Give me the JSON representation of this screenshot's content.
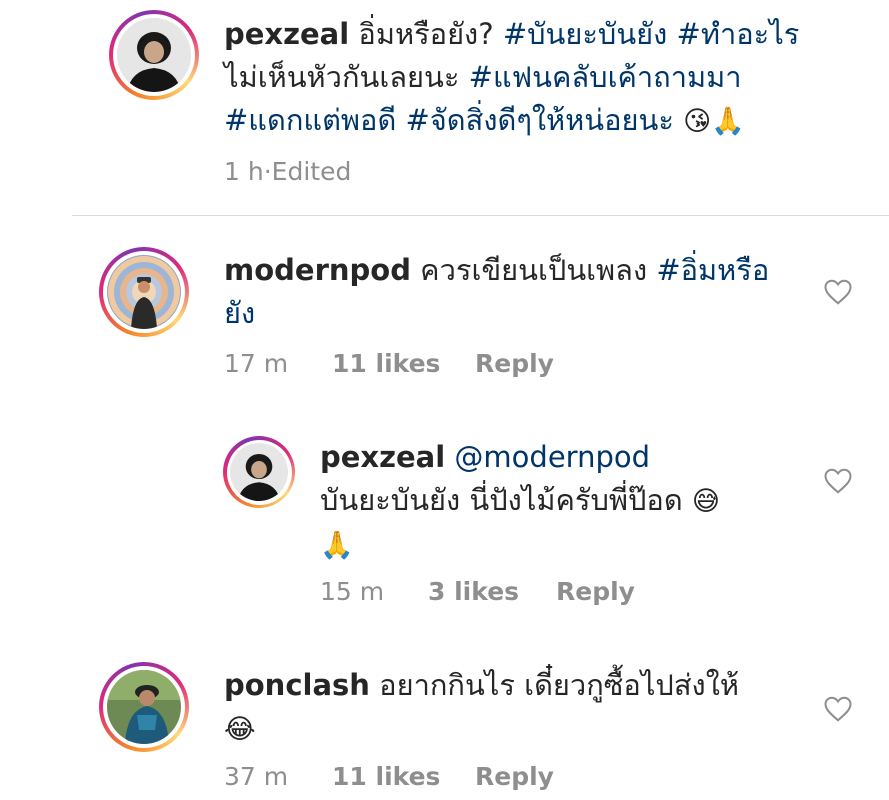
{
  "caption": {
    "username": "pexzeal",
    "line1_text": " อิ่มหรือยัง? ",
    "tag1": "#บันยะบันยัง",
    "tag2": "#ทำอะไร",
    "line2_text": "ไม่เห็นหัวกันเลยนะ ",
    "tag3": "#แฟนคลับเค้าถามมา",
    "tag4": "#แดกแต่พอดี",
    "tag5": "#จัดสิ่งดีๆให้หน่อยนะ",
    "emoji": "😘🙏",
    "time": "1 h",
    "sep": " · ",
    "edited": "Edited"
  },
  "comments": [
    {
      "username": "modernpod",
      "text": " ควรเขียนเป็นเพลง ",
      "tag": "#อิ่มหรือ",
      "tag_cont": "ยัง",
      "time": "17 m",
      "likes": "11 likes",
      "reply": "Reply"
    },
    {
      "username": "pexzeal",
      "mention": "@modernpod",
      "text": "บันยะบันยัง นี่ปังไม้ครับพี่ป๊อด ",
      "emoji1": "😅",
      "emoji2": "🙏",
      "time": "15 m",
      "likes": "3 likes",
      "reply": "Reply"
    },
    {
      "username": "ponclash",
      "text": " อยากกินไร เดี๋ยวกูซื้อไปส่งให้",
      "emoji": "😂",
      "time": "37 m",
      "likes": "11 likes",
      "reply": "Reply"
    }
  ],
  "icons": {
    "like": "heart-outline-icon"
  },
  "colors": {
    "text": "#262626",
    "link": "#003569",
    "meta": "#8e8e8e",
    "divider": "#dbdbdb"
  }
}
